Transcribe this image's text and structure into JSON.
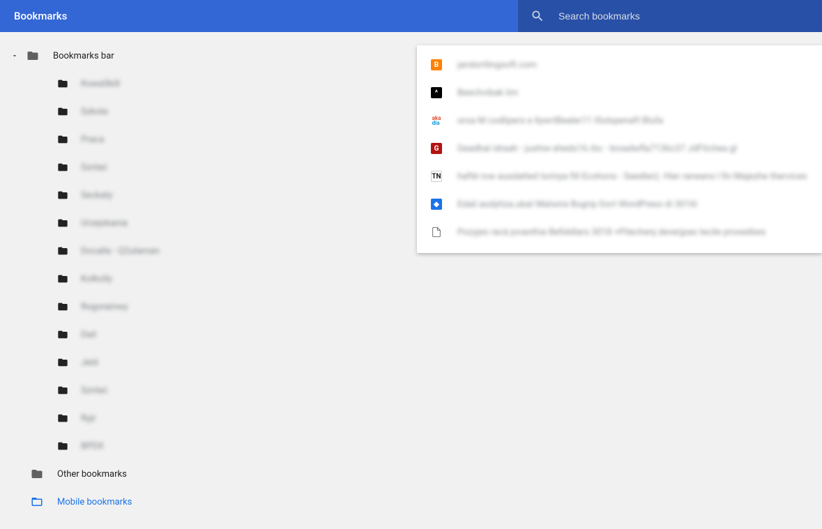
{
  "header": {
    "title": "Bookmarks",
    "search_placeholder": "Search bookmarks"
  },
  "sidebar": {
    "bookmarks_bar": "Bookmarks bar",
    "folders": [
      "KowaSkill",
      "Szkoła",
      "Praca",
      "Sznlać",
      "Seckaty",
      "Urzejskania",
      "Docalla - Q2ułaman",
      "Kolkolly",
      "Rogorainwy",
      "Dail",
      "Jeld",
      "Sznlać",
      "Ryjr",
      "BPDX"
    ],
    "other": "Other bookmarks",
    "mobile": "Mobile bookmarks"
  },
  "bookmarks": [
    {
      "fav": "blogger",
      "text": "jandortlingsoft.com"
    },
    {
      "fav": "black",
      "text": "Beechvibak lim"
    },
    {
      "fav": "aka",
      "text": "oroa M codlipers e llywrtBealer11 ISolspenaft Blufa"
    },
    {
      "fav": "g",
      "text": "Geadhal idraah - jushiw eheds16.rbc - broadwfla7136c37 JdFtichea gl"
    },
    {
      "fav": "tn",
      "text": "hafté row ausdatted torinya fill Ecohons - Seedlen). Hier raneans I fin Majezhe thervices"
    },
    {
      "fav": "blue",
      "text": "Edail aodytiza.ubat Matwira Bugrip Dort WordPress di 3016l"
    },
    {
      "fav": "doc",
      "text": "Pozyjes racà jovanlhia Befiddlars 3018 +Pilechenj deverjpas tecile prowetbes"
    }
  ]
}
